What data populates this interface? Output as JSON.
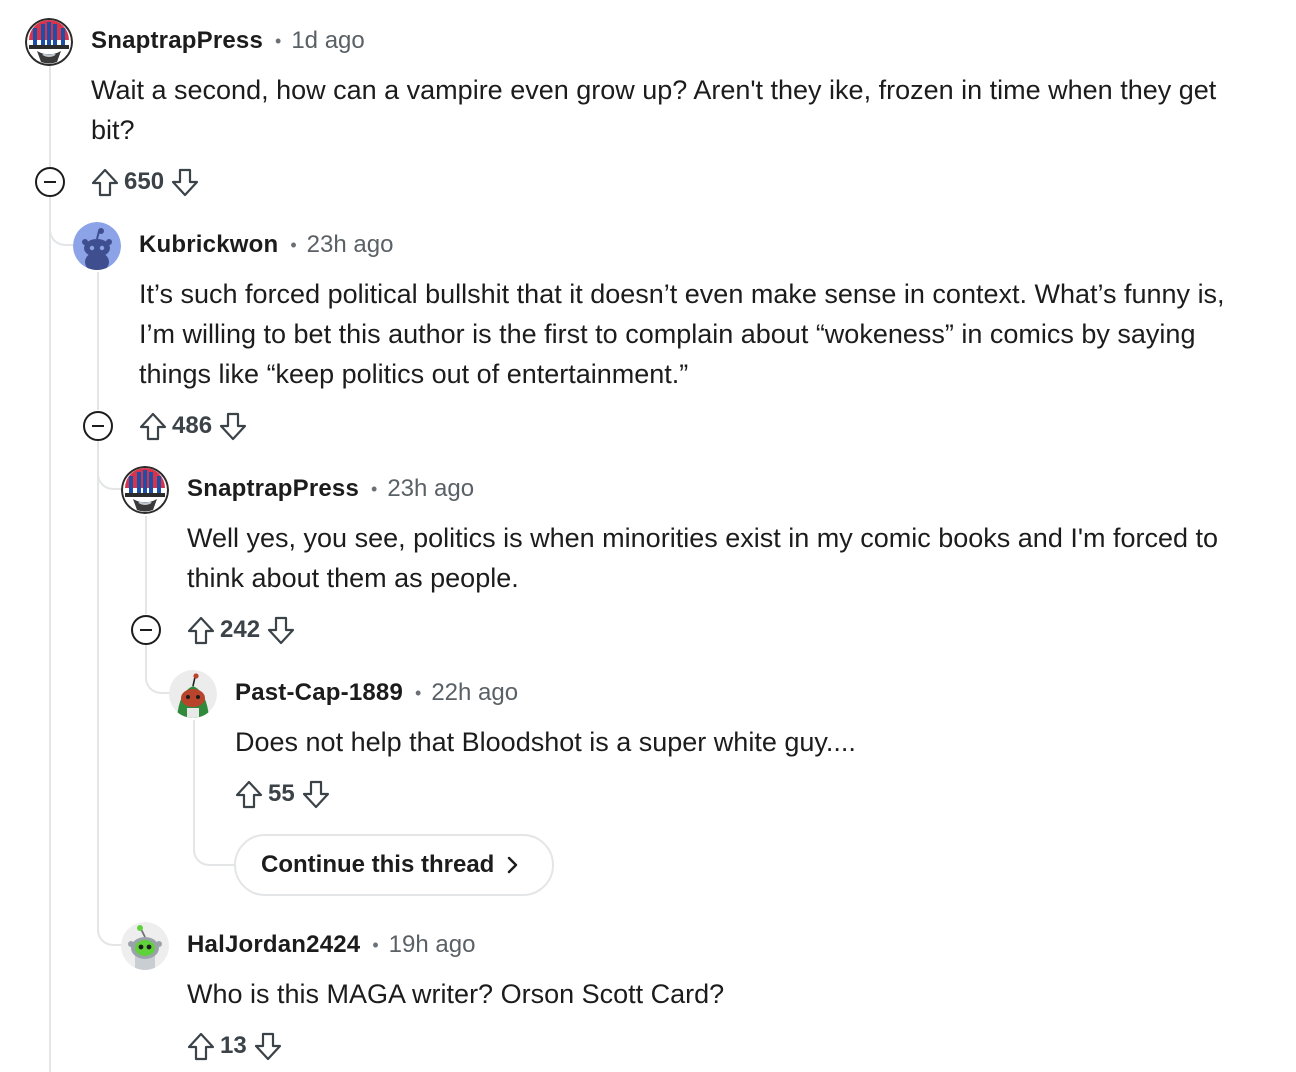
{
  "comments": [
    {
      "author": "SnaptrapPress",
      "separator": "•",
      "time": "1d ago",
      "body": "Wait a second, how can a vampire even grow up? Aren't they ike, frozen in time when they get bit?",
      "score": "650",
      "avatar_icon": "snaptrap-avatar-icon"
    },
    {
      "author": "Kubrickwon",
      "separator": "•",
      "time": "23h ago",
      "body": "It’s such forced political bullshit that it doesn’t even make sense in context. What’s funny is, I’m willing to bet this author is the first to complain about “wokeness” in comics by saying things like “keep politics out of entertainment.”",
      "score": "486",
      "avatar_icon": "snoo-default-avatar-icon"
    },
    {
      "author": "SnaptrapPress",
      "separator": "•",
      "time": "23h ago",
      "body": "Well yes, you see, politics is when minorities exist in my comic books and I'm forced to think about them as people.",
      "score": "242",
      "avatar_icon": "snaptrap-avatar-icon"
    },
    {
      "author": "Past-Cap-1889",
      "separator": "•",
      "time": "22h ago",
      "body": "Does not help that Bloodshot is a super white guy....",
      "score": "55",
      "avatar_icon": "snoo-green-hood-avatar-icon"
    },
    {
      "author": "HalJordan2424",
      "separator": "•",
      "time": "19h ago",
      "body": "Who is this MAGA writer? Orson Scott Card?",
      "score": "13",
      "avatar_icon": "snoo-robot-avatar-icon"
    }
  ],
  "continue_thread": {
    "label": "Continue this thread"
  },
  "colors": {
    "text": "#1c1c1c",
    "meta": "#5a6166",
    "thread_line": "#e3e5e7",
    "score": "#3c4348"
  }
}
